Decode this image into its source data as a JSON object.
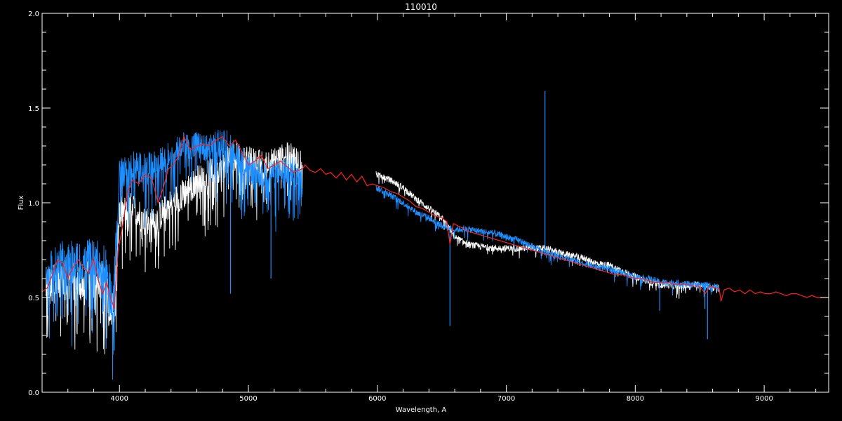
{
  "chart_data": {
    "type": "line",
    "title": "110010",
    "xlabel": "Wavelength, A",
    "ylabel": "Flux",
    "xlim": [
      3400,
      9500
    ],
    "ylim": [
      0.0,
      2.0
    ],
    "x_ticks": [
      4000,
      5000,
      6000,
      7000,
      8000,
      9000
    ],
    "x_tick_labels": [
      "4000",
      "5000",
      "6000",
      "7000",
      "8000",
      "9000"
    ],
    "y_ticks": [
      0.0,
      0.5,
      1.0,
      1.5,
      2.0
    ],
    "y_tick_labels": [
      "0.0",
      "0.5",
      "1.0",
      "1.5",
      "2.0"
    ],
    "grid": false,
    "background": "#000000",
    "series": [
      {
        "color": "#ffffff",
        "style": "noisy",
        "points": [
          [
            3430,
            0.55
          ],
          [
            3550,
            0.6
          ],
          [
            3700,
            0.58
          ],
          [
            3800,
            0.65
          ],
          [
            3900,
            0.55
          ],
          [
            3950,
            0.42
          ],
          [
            4000,
            0.95
          ],
          [
            4100,
            0.98
          ],
          [
            4200,
            0.9
          ],
          [
            4300,
            0.92
          ],
          [
            4400,
            1.0
          ],
          [
            4500,
            1.05
          ],
          [
            4600,
            1.12
          ],
          [
            4700,
            1.15
          ],
          [
            4800,
            1.2
          ],
          [
            4900,
            1.25
          ],
          [
            5000,
            1.22
          ],
          [
            5100,
            1.2
          ],
          [
            5200,
            1.22
          ],
          [
            5300,
            1.24
          ],
          [
            5420,
            1.22
          ],
          [
            5990,
            1.15
          ],
          [
            6100,
            1.12
          ],
          [
            6200,
            1.08
          ],
          [
            6300,
            1.02
          ],
          [
            6400,
            0.97
          ],
          [
            6500,
            0.92
          ],
          [
            6600,
            0.82
          ],
          [
            6700,
            0.78
          ],
          [
            6800,
            0.77
          ],
          [
            6900,
            0.76
          ],
          [
            7000,
            0.76
          ],
          [
            7100,
            0.76
          ],
          [
            7200,
            0.76
          ],
          [
            7300,
            0.76
          ],
          [
            7400,
            0.74
          ],
          [
            7500,
            0.72
          ],
          [
            7600,
            0.71
          ],
          [
            7700,
            0.68
          ],
          [
            7800,
            0.67
          ],
          [
            7900,
            0.64
          ],
          [
            8000,
            0.61
          ],
          [
            8100,
            0.58
          ],
          [
            8200,
            0.57
          ],
          [
            8300,
            0.56
          ],
          [
            8400,
            0.56
          ],
          [
            8500,
            0.57
          ],
          [
            8600,
            0.55
          ],
          [
            8650,
            0.55
          ]
        ]
      },
      {
        "color": "#1e8fff",
        "style": "noisy",
        "points": [
          [
            3430,
            0.62
          ],
          [
            3550,
            0.7
          ],
          [
            3700,
            0.68
          ],
          [
            3800,
            0.72
          ],
          [
            3900,
            0.65
          ],
          [
            3950,
            0.45
          ],
          [
            4000,
            1.15
          ],
          [
            4100,
            1.2
          ],
          [
            4200,
            1.18
          ],
          [
            4300,
            1.2
          ],
          [
            4400,
            1.25
          ],
          [
            4500,
            1.3
          ],
          [
            4600,
            1.3
          ],
          [
            4700,
            1.28
          ],
          [
            4800,
            1.32
          ],
          [
            4900,
            1.28
          ],
          [
            5000,
            1.18
          ],
          [
            5100,
            1.15
          ],
          [
            5200,
            1.15
          ],
          [
            5300,
            1.17
          ],
          [
            5420,
            1.15
          ],
          [
            5990,
            1.08
          ],
          [
            6100,
            1.04
          ],
          [
            6200,
            1.0
          ],
          [
            6300,
            0.95
          ],
          [
            6400,
            0.92
          ],
          [
            6500,
            0.88
          ],
          [
            6600,
            0.86
          ],
          [
            6700,
            0.86
          ],
          [
            6800,
            0.85
          ],
          [
            6900,
            0.84
          ],
          [
            7000,
            0.82
          ],
          [
            7100,
            0.8
          ],
          [
            7200,
            0.77
          ],
          [
            7300,
            0.74
          ],
          [
            7400,
            0.72
          ],
          [
            7500,
            0.7
          ],
          [
            7600,
            0.68
          ],
          [
            7700,
            0.66
          ],
          [
            7800,
            0.65
          ],
          [
            7900,
            0.63
          ],
          [
            8000,
            0.61
          ],
          [
            8100,
            0.6
          ],
          [
            8200,
            0.58
          ],
          [
            8300,
            0.58
          ],
          [
            8400,
            0.57
          ],
          [
            8500,
            0.57
          ],
          [
            8600,
            0.56
          ],
          [
            8650,
            0.55
          ]
        ],
        "features": [
          {
            "x": 3960,
            "y": 0.22
          },
          {
            "x": 4861,
            "y": 0.52
          },
          {
            "x": 5175,
            "y": 0.6
          },
          {
            "x": 6563,
            "y": 0.35
          },
          {
            "x": 7300,
            "y": 1.59
          },
          {
            "x": 8190,
            "y": 0.43
          },
          {
            "x": 8540,
            "y": 0.44
          },
          {
            "x": 8560,
            "y": 0.28
          }
        ]
      },
      {
        "color": "#ff2020",
        "style": "model",
        "points": [
          [
            3400,
            0.53
          ],
          [
            3440,
            0.55
          ],
          [
            3480,
            0.62
          ],
          [
            3520,
            0.7
          ],
          [
            3560,
            0.68
          ],
          [
            3600,
            0.6
          ],
          [
            3640,
            0.66
          ],
          [
            3680,
            0.7
          ],
          [
            3720,
            0.66
          ],
          [
            3760,
            0.63
          ],
          [
            3800,
            0.7
          ],
          [
            3840,
            0.58
          ],
          [
            3870,
            0.52
          ],
          [
            3900,
            0.58
          ],
          [
            3930,
            0.5
          ],
          [
            3960,
            0.44
          ],
          [
            3990,
            0.75
          ],
          [
            4030,
            0.9
          ],
          [
            4060,
            1.05
          ],
          [
            4100,
            1.12
          ],
          [
            4150,
            1.1
          ],
          [
            4200,
            1.15
          ],
          [
            4250,
            1.13
          ],
          [
            4300,
            1.0
          ],
          [
            4340,
            1.08
          ],
          [
            4380,
            1.18
          ],
          [
            4420,
            1.2
          ],
          [
            4460,
            1.25
          ],
          [
            4500,
            1.35
          ],
          [
            4550,
            1.28
          ],
          [
            4600,
            1.3
          ],
          [
            4650,
            1.31
          ],
          [
            4700,
            1.3
          ],
          [
            4750,
            1.33
          ],
          [
            4800,
            1.35
          ],
          [
            4850,
            1.3
          ],
          [
            4900,
            1.33
          ],
          [
            4950,
            1.27
          ],
          [
            5000,
            1.2
          ],
          [
            5050,
            1.22
          ],
          [
            5100,
            1.25
          ],
          [
            5150,
            1.18
          ],
          [
            5200,
            1.2
          ],
          [
            5250,
            1.22
          ],
          [
            5300,
            1.19
          ],
          [
            5350,
            1.16
          ],
          [
            5420,
            1.18
          ],
          [
            5440,
            1.2
          ],
          [
            5480,
            1.17
          ],
          [
            5520,
            1.16
          ],
          [
            5560,
            1.18
          ],
          [
            5600,
            1.15
          ],
          [
            5640,
            1.16
          ],
          [
            5680,
            1.13
          ],
          [
            5720,
            1.16
          ],
          [
            5760,
            1.12
          ],
          [
            5800,
            1.15
          ],
          [
            5840,
            1.11
          ],
          [
            5880,
            1.14
          ],
          [
            5920,
            1.09
          ],
          [
            5960,
            1.1
          ],
          [
            6000,
            1.09
          ],
          [
            6050,
            1.08
          ],
          [
            6100,
            1.06
          ],
          [
            6150,
            1.05
          ],
          [
            6200,
            1.03
          ],
          [
            6250,
            1.01
          ],
          [
            6300,
            0.98
          ],
          [
            6350,
            0.97
          ],
          [
            6400,
            0.95
          ],
          [
            6450,
            0.93
          ],
          [
            6500,
            0.92
          ],
          [
            6540,
            0.9
          ],
          [
            6563,
            0.78
          ],
          [
            6590,
            0.89
          ],
          [
            6650,
            0.87
          ],
          [
            6700,
            0.85
          ],
          [
            6750,
            0.84
          ],
          [
            6800,
            0.83
          ],
          [
            6850,
            0.82
          ],
          [
            6900,
            0.81
          ],
          [
            6950,
            0.8
          ],
          [
            7000,
            0.79
          ],
          [
            7050,
            0.78
          ],
          [
            7100,
            0.77
          ],
          [
            7150,
            0.76
          ],
          [
            7200,
            0.75
          ],
          [
            7250,
            0.74
          ],
          [
            7300,
            0.73
          ],
          [
            7350,
            0.72
          ],
          [
            7400,
            0.71
          ],
          [
            7450,
            0.7
          ],
          [
            7500,
            0.69
          ],
          [
            7550,
            0.68
          ],
          [
            7600,
            0.67
          ],
          [
            7650,
            0.66
          ],
          [
            7700,
            0.65
          ],
          [
            7750,
            0.64
          ],
          [
            7800,
            0.63
          ],
          [
            7850,
            0.62
          ],
          [
            7900,
            0.62
          ],
          [
            7950,
            0.61
          ],
          [
            8000,
            0.6
          ],
          [
            8050,
            0.6
          ],
          [
            8100,
            0.59
          ],
          [
            8150,
            0.58
          ],
          [
            8200,
            0.58
          ],
          [
            8250,
            0.58
          ],
          [
            8300,
            0.57
          ],
          [
            8350,
            0.57
          ],
          [
            8400,
            0.57
          ],
          [
            8450,
            0.56
          ],
          [
            8500,
            0.56
          ],
          [
            8542,
            0.52
          ],
          [
            8580,
            0.56
          ],
          [
            8620,
            0.55
          ],
          [
            8650,
            0.55
          ],
          [
            8665,
            0.48
          ],
          [
            8690,
            0.54
          ],
          [
            8730,
            0.55
          ],
          [
            8770,
            0.53
          ],
          [
            8810,
            0.54
          ],
          [
            8850,
            0.52
          ],
          [
            8890,
            0.54
          ],
          [
            8930,
            0.52
          ],
          [
            8970,
            0.53
          ],
          [
            9010,
            0.52
          ],
          [
            9050,
            0.52
          ],
          [
            9090,
            0.53
          ],
          [
            9130,
            0.52
          ],
          [
            9170,
            0.51
          ],
          [
            9210,
            0.52
          ],
          [
            9250,
            0.52
          ],
          [
            9290,
            0.51
          ],
          [
            9330,
            0.5
          ],
          [
            9370,
            0.51
          ],
          [
            9410,
            0.5
          ],
          [
            9460,
            0.5
          ],
          [
            9500,
            0.5
          ]
        ]
      },
      {
        "color": "#1e8fff",
        "style": "error",
        "points": [
          [
            3430,
            0.01
          ],
          [
            5420,
            0.01
          ],
          [
            5990,
            0.01
          ],
          [
            8650,
            0.01
          ]
        ]
      }
    ]
  }
}
